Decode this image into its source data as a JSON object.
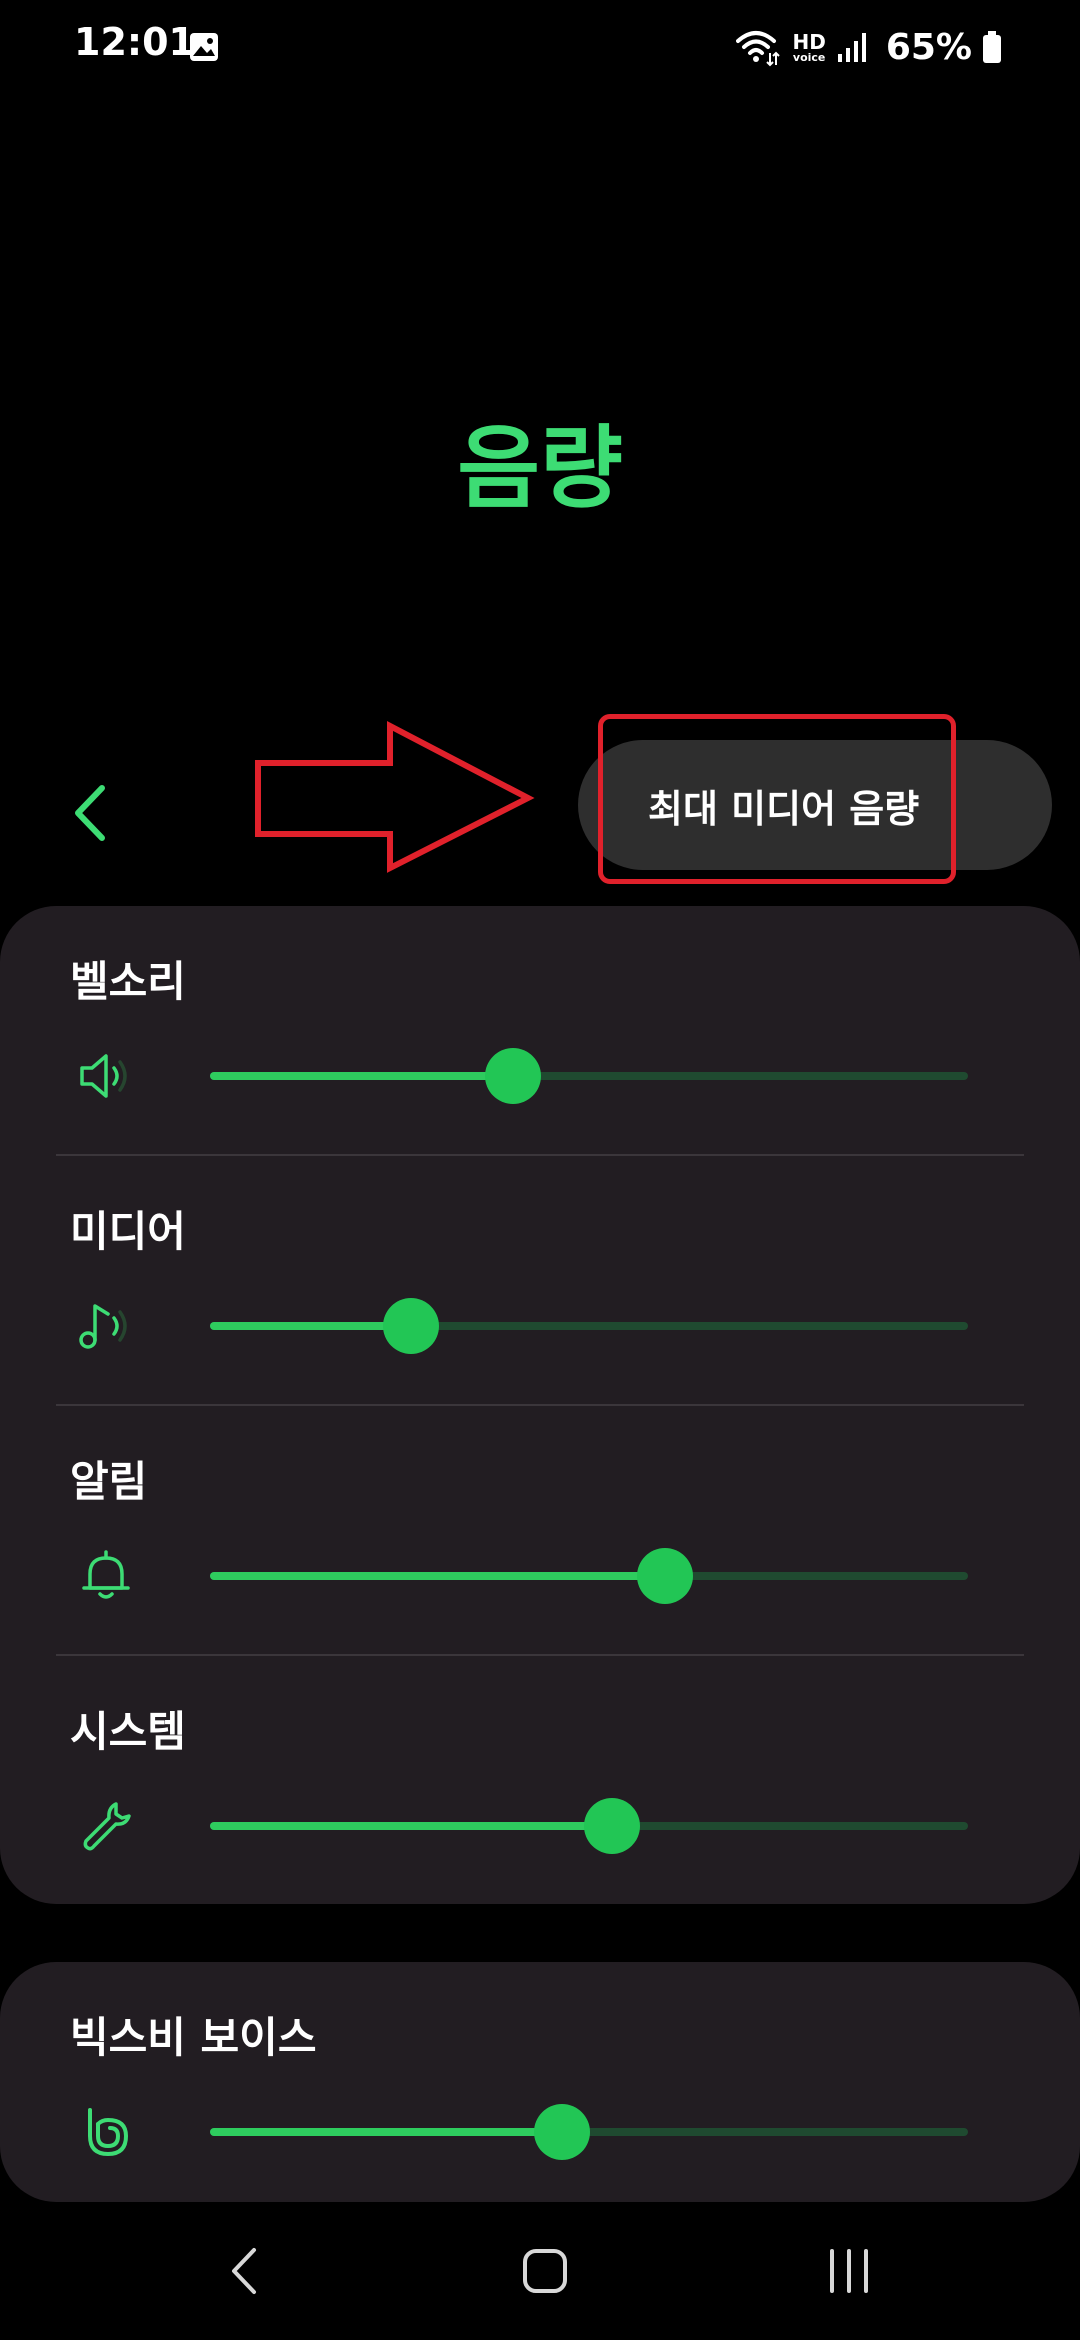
{
  "status_bar": {
    "time": "12:01",
    "hd_label": "HD",
    "voice_label": "voice",
    "battery": "65%"
  },
  "title": "음량",
  "max_media_label": "최대 미디어 음량",
  "sliders": [
    {
      "label": "벨소리",
      "icon": "speaker-icon",
      "level": 0.4
    },
    {
      "label": "미디어",
      "icon": "music-note-icon",
      "level": 0.265
    },
    {
      "label": "알림",
      "icon": "bell-icon",
      "level": 0.6
    },
    {
      "label": "시스템",
      "icon": "wrench-icon",
      "level": 0.53
    }
  ],
  "bixby": {
    "label": "빅스비 보이스",
    "icon": "bixby-icon",
    "level": 0.465
  },
  "colors": {
    "accent": "#3ddc74",
    "slider_fill": "#2ecc5e",
    "slider_track": "#1f4a30",
    "card_bg": "#221d22",
    "highlight": "#e0212b"
  }
}
